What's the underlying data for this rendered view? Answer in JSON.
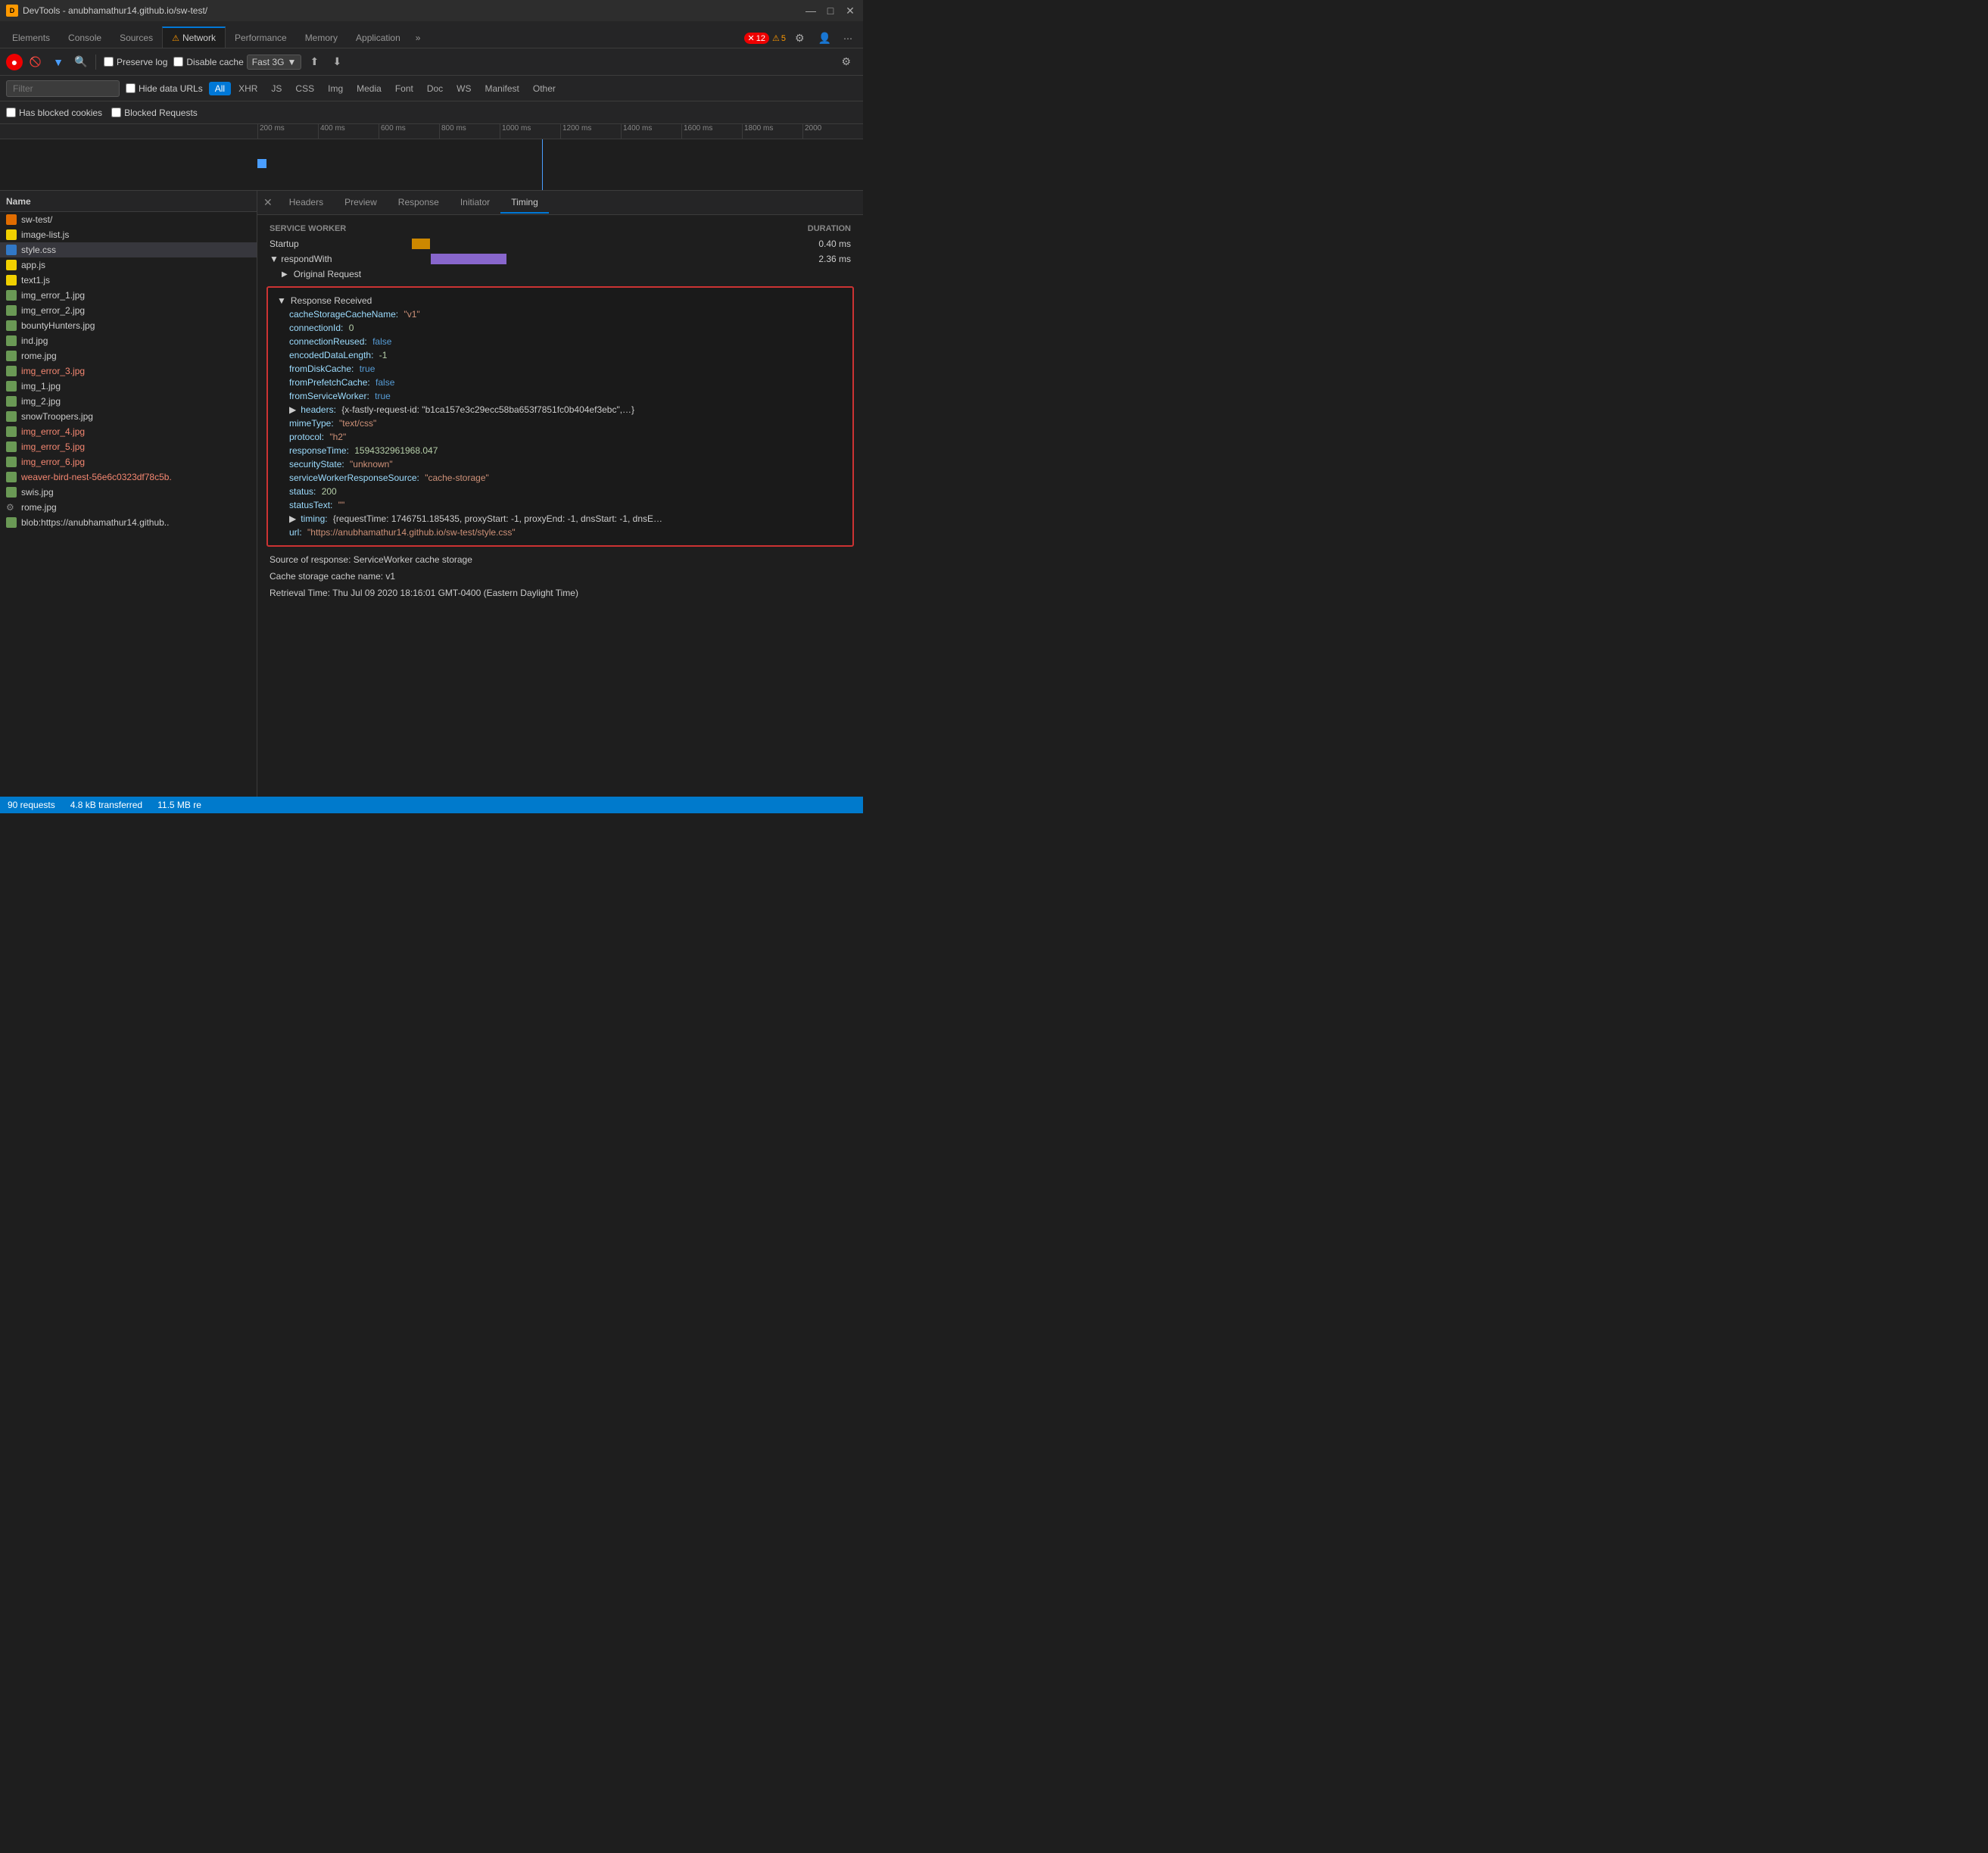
{
  "titlebar": {
    "title": "DevTools - anubhamathur14.github.io/sw-test/",
    "icon_label": "DT",
    "min": "—",
    "max": "□",
    "close": "✕"
  },
  "tabs": {
    "items": [
      {
        "label": "Elements",
        "active": false,
        "icon": null
      },
      {
        "label": "Console",
        "active": false,
        "icon": null
      },
      {
        "label": "Sources",
        "active": false,
        "icon": null
      },
      {
        "label": "Network",
        "active": true,
        "icon": "⚠",
        "icon_color": "#f90"
      },
      {
        "label": "Performance",
        "active": false,
        "icon": null
      },
      {
        "label": "Memory",
        "active": false,
        "icon": null
      },
      {
        "label": "Application",
        "active": false,
        "icon": null
      }
    ],
    "more": "»",
    "badge_error_count": "12",
    "badge_warning_count": "5"
  },
  "toolbar": {
    "preserve_log": "Preserve log",
    "disable_cache": "Disable cache",
    "throttle": "Fast 3G"
  },
  "filterbar": {
    "placeholder": "Filter",
    "hide_data_urls": "Hide data URLs",
    "types": [
      "All",
      "XHR",
      "JS",
      "CSS",
      "Img",
      "Media",
      "Font",
      "Doc",
      "WS",
      "Manifest",
      "Other"
    ],
    "active_type": "All"
  },
  "cookiebar": {
    "has_blocked_cookies": "Has blocked cookies",
    "blocked_requests": "Blocked Requests"
  },
  "timeline": {
    "labels": [
      "200 ms",
      "400 ms",
      "600 ms",
      "800 ms",
      "1000 ms",
      "1200 ms",
      "1400 ms",
      "1600 ms",
      "1800 ms",
      "2000"
    ]
  },
  "filelist": {
    "header": "Name",
    "files": [
      {
        "name": "sw-test/",
        "type": "html",
        "error": false
      },
      {
        "name": "image-list.js",
        "type": "js",
        "error": false
      },
      {
        "name": "style.css",
        "type": "css",
        "error": false,
        "selected": true
      },
      {
        "name": "app.js",
        "type": "js",
        "error": false
      },
      {
        "name": "text1.js",
        "type": "js",
        "error": false
      },
      {
        "name": "img_error_1.jpg",
        "type": "img",
        "error": false
      },
      {
        "name": "img_error_2.jpg",
        "type": "img",
        "error": false
      },
      {
        "name": "bountyHunters.jpg",
        "type": "img",
        "error": false
      },
      {
        "name": "ind.jpg",
        "type": "img",
        "error": false
      },
      {
        "name": "rome.jpg",
        "type": "img",
        "error": false
      },
      {
        "name": "img_error_3.jpg",
        "type": "img",
        "error": true
      },
      {
        "name": "img_1.jpg",
        "type": "img",
        "error": false
      },
      {
        "name": "img_2.jpg",
        "type": "img",
        "error": false
      },
      {
        "name": "snowTroopers.jpg",
        "type": "img",
        "error": false
      },
      {
        "name": "img_error_4.jpg",
        "type": "img",
        "error": true
      },
      {
        "name": "img_error_5.jpg",
        "type": "img",
        "error": true
      },
      {
        "name": "img_error_6.jpg",
        "type": "img",
        "error": true
      },
      {
        "name": "weaver-bird-nest-56e6c0323df78c5b.",
        "type": "img",
        "error": true
      },
      {
        "name": "swis.jpg",
        "type": "img",
        "error": false
      },
      {
        "name": "rome.jpg",
        "type": "gear",
        "error": false
      },
      {
        "name": "blob:https://anubhamathur14.github..",
        "type": "img",
        "error": false
      }
    ]
  },
  "detail": {
    "tabs": [
      "Headers",
      "Preview",
      "Response",
      "Initiator",
      "Timing"
    ],
    "active_tab": "Timing",
    "timing": {
      "service_worker_label": "Service Worker",
      "duration_label": "DURATION",
      "startup_label": "Startup",
      "startup_duration": "0.40 ms",
      "respond_with_label": "▼ respondWith",
      "respond_with_duration": "2.36 ms",
      "original_request_label": "▶ Original Request",
      "response_received_label": "▼ Response Received",
      "fields": [
        {
          "key": "cacheStorageCacheName:",
          "value": "\"v1\"",
          "type": "str"
        },
        {
          "key": "connectionId:",
          "value": "0",
          "type": "num"
        },
        {
          "key": "connectionReused:",
          "value": "false",
          "type": "bool"
        },
        {
          "key": "encodedDataLength:",
          "value": "-1",
          "type": "num"
        },
        {
          "key": "fromDiskCache:",
          "value": "true",
          "type": "bool"
        },
        {
          "key": "fromPrefetchCache:",
          "value": "false",
          "type": "bool"
        },
        {
          "key": "fromServiceWorker:",
          "value": "true",
          "type": "bool"
        },
        {
          "key": "headers:",
          "value": "{x-fastly-request-id: \"b1ca157e3c29ecc58ba653f7851fc0b404ef3ebc\",...}",
          "type": "expand"
        },
        {
          "key": "mimeType:",
          "value": "\"text/css\"",
          "type": "str"
        },
        {
          "key": "protocol:",
          "value": "\"h2\"",
          "type": "str"
        },
        {
          "key": "responseTime:",
          "value": "1594332961968.047",
          "type": "num"
        },
        {
          "key": "securityState:",
          "value": "\"unknown\"",
          "type": "str"
        },
        {
          "key": "serviceWorkerResponseSource:",
          "value": "\"cache-storage\"",
          "type": "str"
        },
        {
          "key": "status:",
          "value": "200",
          "type": "num"
        },
        {
          "key": "statusText:",
          "value": "\"\"",
          "type": "str"
        },
        {
          "key": "timing:",
          "value": "{requestTime: 1746751.185435, proxyStart: -1, proxyEnd: -1, dnsStart: -1, dnsE…",
          "type": "expand"
        },
        {
          "key": "url:",
          "value": "\"https://anubhamathur14.github.io/sw-test/style.css\"",
          "type": "url"
        }
      ],
      "footer_lines": [
        "Source of response: ServiceWorker cache storage",
        "Cache storage cache name: v1",
        "Retrieval Time: Thu Jul 09 2020 18:16:01 GMT-0400 (Eastern Daylight Time)"
      ]
    }
  },
  "statusbar": {
    "requests": "90 requests",
    "transferred": "4.8 kB transferred",
    "size": "11.5 MB re"
  }
}
